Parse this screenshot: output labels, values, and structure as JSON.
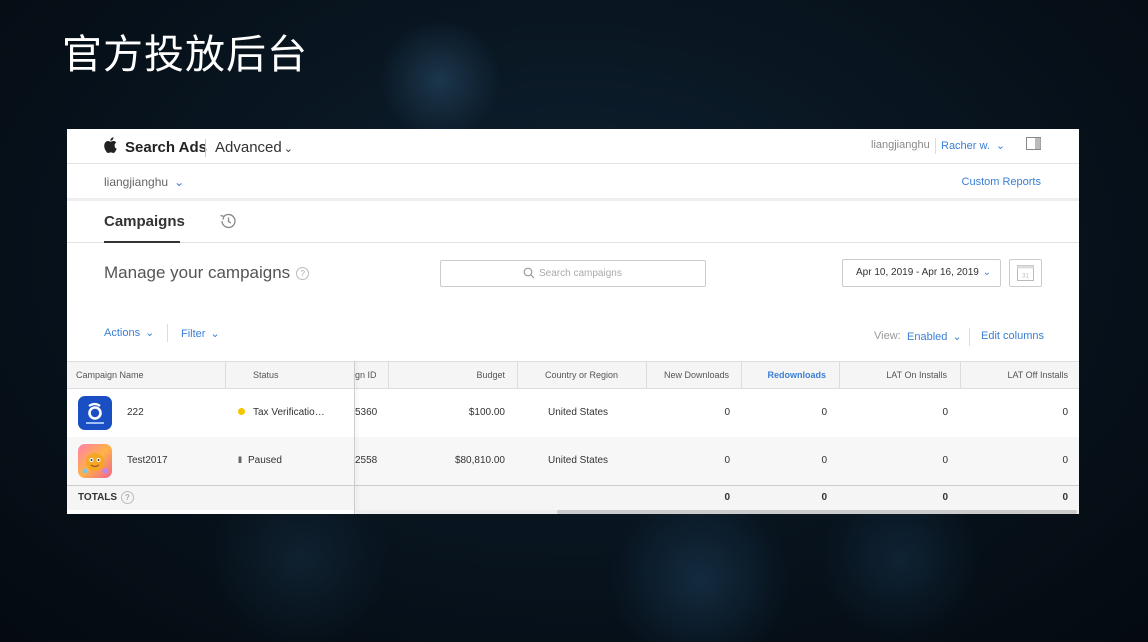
{
  "slide": {
    "title": "官方投放后台"
  },
  "header": {
    "brand": "Search Ads",
    "mode": "Advanced",
    "mode_chevron": "⌄",
    "user_org": "liangjianghu",
    "user_menu": "Racher w.",
    "chevron": "⌄"
  },
  "orgbar": {
    "org_name": "liangjianghu",
    "custom_reports": "Custom Reports"
  },
  "tabs": {
    "campaigns": "Campaigns"
  },
  "page": {
    "heading": "Manage your campaigns",
    "help": "?",
    "search_placeholder": "Search campaigns",
    "date_range": "Apr 10, 2019 - Apr 16, 2019",
    "calendar_day": "31"
  },
  "toolbar": {
    "actions": "Actions",
    "filter": "Filter",
    "view_label": "View:",
    "view_value": "Enabled",
    "edit_columns": "Edit columns"
  },
  "table": {
    "columns": {
      "name": "Campaign Name",
      "status": "Status",
      "id": "gn ID",
      "budget": "Budget",
      "country": "Country or Region",
      "new_downloads": "New Downloads",
      "redownloads": "Redownloads",
      "lat_on": "LAT On Installs",
      "lat_off": "LAT Off Installs"
    },
    "rows": [
      {
        "name": "222",
        "status": "Tax Verificatio…",
        "id": "5360",
        "budget": "$100.00",
        "country": "United States",
        "new_downloads": "0",
        "redownloads": "0",
        "lat_on": "0",
        "lat_off": "0"
      },
      {
        "name": "Test2017",
        "status": "Paused",
        "pause_glyph": "II",
        "id": "2558",
        "budget": "$80,810.00",
        "country": "United States",
        "new_downloads": "0",
        "redownloads": "0",
        "lat_on": "0",
        "lat_off": "0"
      }
    ],
    "totals": {
      "label": "TOTALS",
      "help": "?",
      "new_downloads": "0",
      "redownloads": "0",
      "lat_on": "0",
      "lat_off": "0"
    }
  },
  "colors": {
    "accent": "#3a7fd5",
    "warning": "#f5c400"
  }
}
